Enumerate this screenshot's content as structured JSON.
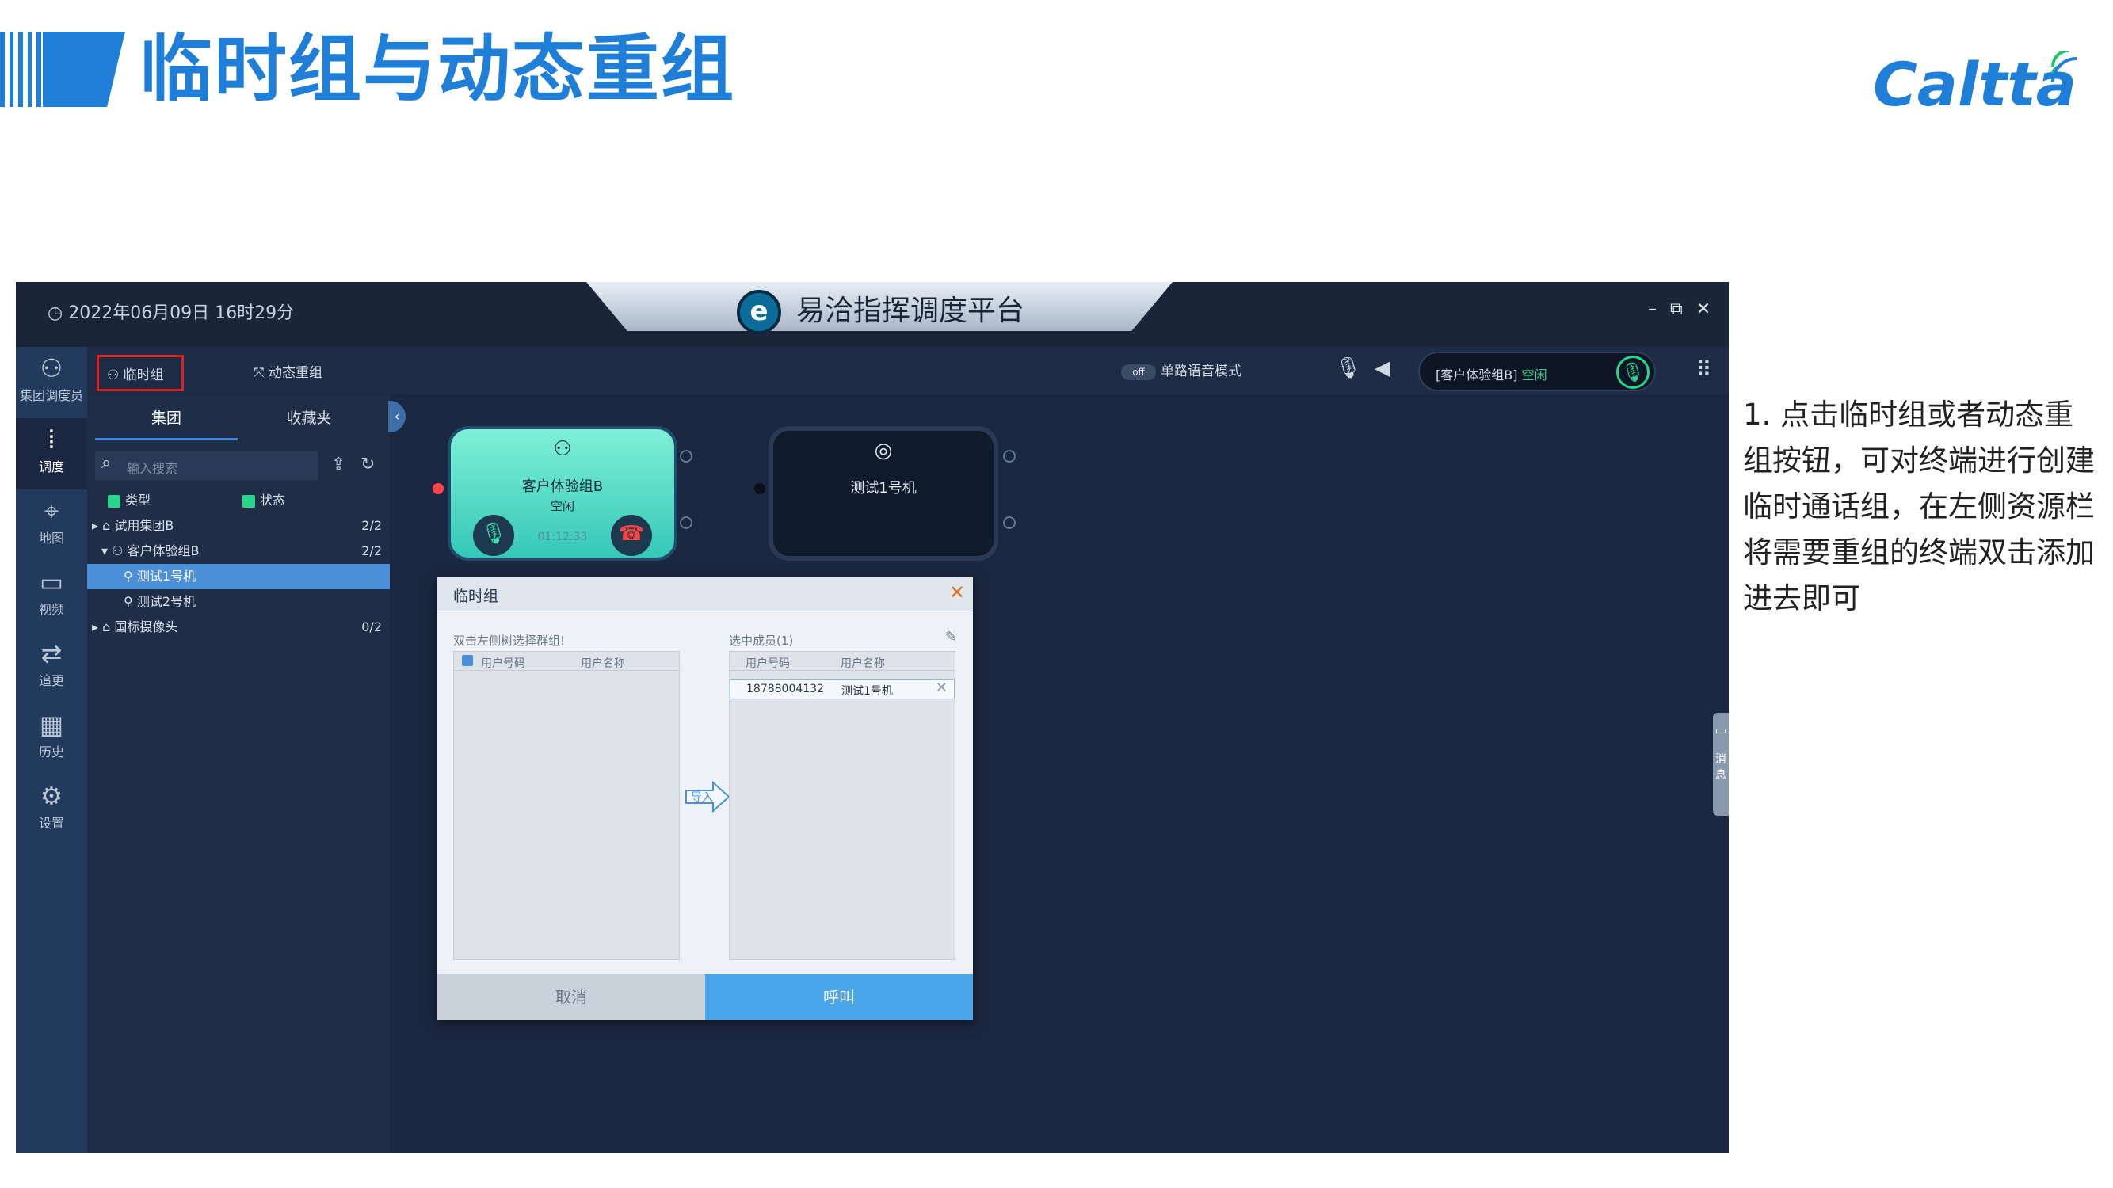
{
  "slide": {
    "title": "临时组与动态重组",
    "brand": "Caltta",
    "instructions": "1. 点击临时组或者动态重组按钮，可对终端进行创建临时通话组，在左侧资源栏将需要重组的终端双击添加进去即可",
    "colors": {
      "accent": "#1f7fd8"
    }
  },
  "app": {
    "datetime": "2022年06月09日 16时29分",
    "title": "易洽指挥调度平台",
    "window_controls": [
      "–",
      "⧉",
      "✕"
    ],
    "toolbar": {
      "temp_group": "临时组",
      "dynamic_regroup": "动态重组",
      "toggle_state": "off",
      "mode_label": "单路语音模式",
      "status_group": "[客户体验组B]",
      "status_state": "空闲"
    },
    "nav": [
      {
        "label": "集团调度员",
        "icon": "user-icon"
      },
      {
        "label": "调度",
        "icon": "waveform-icon"
      },
      {
        "label": "地图",
        "icon": "map-icon"
      },
      {
        "label": "视频",
        "icon": "video-icon"
      },
      {
        "label": "追更",
        "icon": "track-icon"
      },
      {
        "label": "历史",
        "icon": "table-icon"
      },
      {
        "label": "设置",
        "icon": "gear-icon"
      }
    ],
    "resource": {
      "tabs": [
        "集团",
        "收藏夹"
      ],
      "search_placeholder": "输入搜索",
      "filters": [
        "类型",
        "状态"
      ],
      "tree": [
        {
          "label": "试用集团B",
          "count": "2/2"
        },
        {
          "label": "客户体验组B",
          "count": "2/2"
        },
        {
          "label": "测试1号机",
          "count": ""
        },
        {
          "label": "测试2号机",
          "count": ""
        },
        {
          "label": "国标摄像头",
          "count": "0/2"
        }
      ]
    },
    "cards": {
      "group": {
        "name": "客户体验组B",
        "state": "空闲",
        "timer": "01:12:33"
      },
      "terminal": {
        "name": "测试1号机"
      }
    },
    "modal": {
      "title": "临时组",
      "left_hint": "双击左侧树选择群组!",
      "selected_label": "选中成员(1)",
      "col_number": "用户号码",
      "col_name": "用户名称",
      "member": {
        "number": "18788004132",
        "name": "测试1号机"
      },
      "import_label": "导入",
      "cancel": "取消",
      "call": "呼叫"
    },
    "message_tab": "消息"
  }
}
